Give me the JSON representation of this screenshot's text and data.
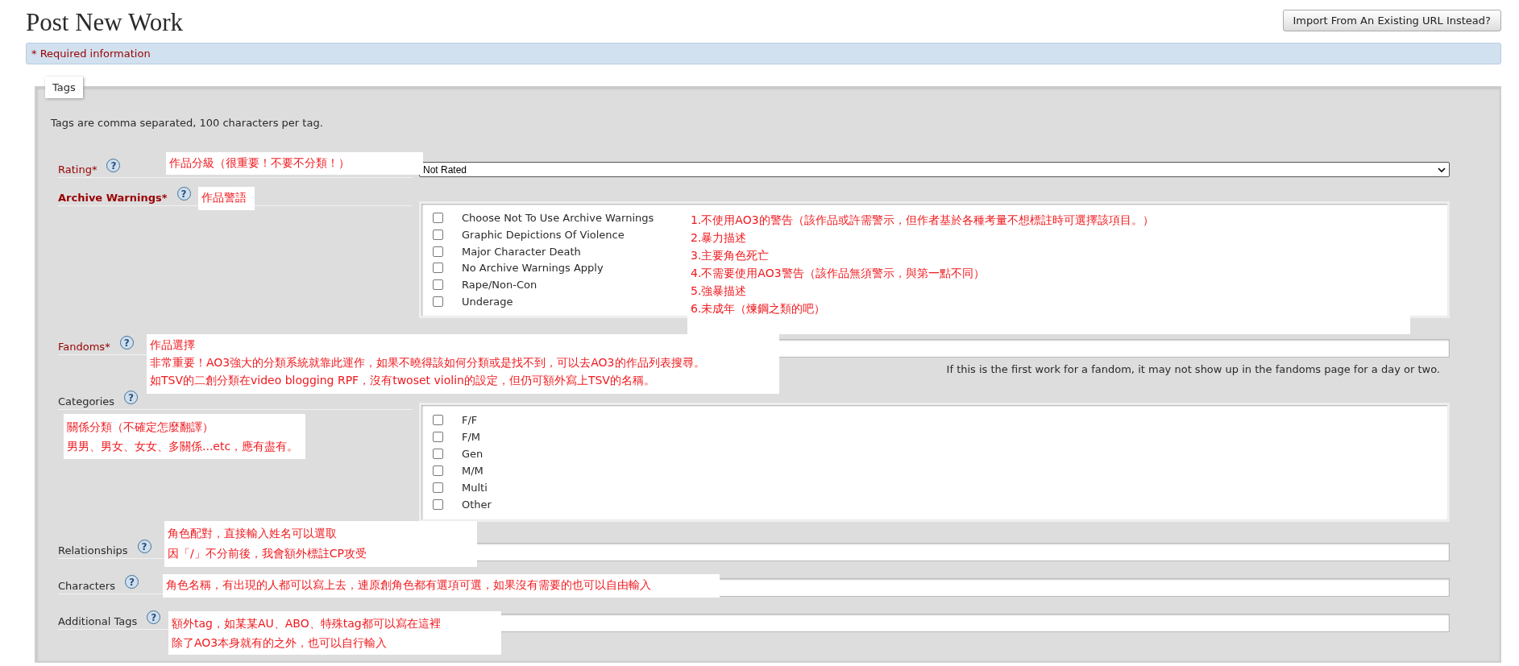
{
  "page_title": "Post New Work",
  "import_button": "Import From An Existing URL Instead?",
  "required_note": "* Required information",
  "fieldset": {
    "legend": "Tags",
    "intro": "Tags are comma separated, 100 characters per tag.",
    "fields": [
      {
        "kind": "select",
        "label": "Rating*",
        "required": true,
        "emphasis": false,
        "help": "?",
        "value": "Not Rated",
        "annotation": [
          "作品分級（很重要！不要不分類！）"
        ]
      },
      {
        "kind": "checks",
        "label": "Archive Warnings*",
        "required": true,
        "emphasis": true,
        "help": "?",
        "options": [
          {
            "label": "Choose Not To Use Archive Warnings",
            "checked": false
          },
          {
            "label": "Graphic Depictions Of Violence",
            "checked": false
          },
          {
            "label": "Major Character Death",
            "checked": false
          },
          {
            "label": "No Archive Warnings Apply",
            "checked": false
          },
          {
            "label": "Rape/Non-Con",
            "checked": false
          },
          {
            "label": "Underage",
            "checked": false
          }
        ],
        "annotation": [
          "作品警語"
        ],
        "annotation_2": [
          "1.不使用AO3的警告（該作品或許需警示，但作者基於各種考量不想標註時可選擇該項目。）",
          "2.暴力描述",
          "3.主要角色死亡",
          "4.不需要使用AO3警告（該作品無須警示，與第一點不同）",
          "5.強暴描述",
          "6.未成年（煉鋼之類的吧）"
        ]
      },
      {
        "kind": "text",
        "label": "Fandoms*",
        "required": true,
        "emphasis": false,
        "help": "?",
        "note": "If this is the first work for a fandom, it may not show up in the fandoms page for a day or two.",
        "annotation": [
          "作品選擇",
          "非常重要！AO3強大的分類系統就靠此運作，如果不曉得該如何分類或是找不到，可以去AO3的作品列表搜尋。",
          "如TSV的二創分類在video blogging RPF，沒有twoset violin的設定，但仍可額外寫上TSV的名稱。"
        ]
      },
      {
        "kind": "checks",
        "label": "Categories",
        "required": false,
        "emphasis": false,
        "help": "?",
        "options": [
          {
            "label": "F/F",
            "checked": false
          },
          {
            "label": "F/M",
            "checked": false
          },
          {
            "label": "Gen",
            "checked": false
          },
          {
            "label": "M/M",
            "checked": false
          },
          {
            "label": "Multi",
            "checked": false
          },
          {
            "label": "Other",
            "checked": false
          }
        ],
        "annotation": [
          "關係分類（不確定怎麼翻譯）",
          "男男、男女、女女、多關係...etc，應有盡有。"
        ]
      },
      {
        "kind": "text",
        "label": "Relationships",
        "required": false,
        "emphasis": false,
        "help": "?",
        "annotation": [
          "角色配對，直接輸入姓名可以選取",
          "因「/」不分前後，我會額外標註CP攻受"
        ]
      },
      {
        "kind": "text",
        "label": "Characters",
        "required": false,
        "emphasis": false,
        "help": "?",
        "annotation": [
          "角色名稱，有出現的人都可以寫上去，連原創角色都有選項可選，如果沒有需要的也可以自由輸入"
        ]
      },
      {
        "kind": "text",
        "label": "Additional Tags",
        "required": false,
        "emphasis": false,
        "help": "?",
        "annotation": [
          "額外tag，如某某AU、ABO、特殊tag都可以寫在這裡",
          "除了AO3本身就有的之外，也可以自行輸入"
        ]
      }
    ]
  }
}
